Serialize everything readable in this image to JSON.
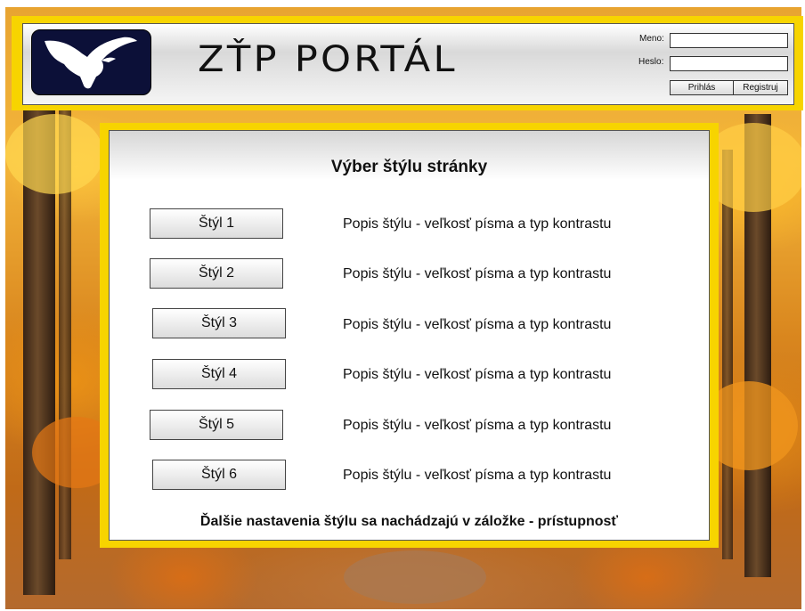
{
  "header": {
    "brand": "ZŤP PORTÁL",
    "login": {
      "username_label": "Meno:",
      "username_value": "",
      "password_label": "Heslo:",
      "password_value": "",
      "login_button": "Prihlás",
      "register_button": "Registruj"
    }
  },
  "main": {
    "title": "Výber štýlu stránky",
    "styles": [
      {
        "label": "Štýl 1",
        "description": "Popis štýlu - veľkosť písma a typ kontrastu"
      },
      {
        "label": "Štýl 2",
        "description": "Popis štýlu - veľkosť písma a typ kontrastu"
      },
      {
        "label": "Štýl 3",
        "description": "Popis štýlu - veľkosť písma a typ kontrastu"
      },
      {
        "label": "Štýl 4",
        "description": "Popis štýlu - veľkosť písma a typ kontrastu"
      },
      {
        "label": "Štýl 5",
        "description": "Popis štýlu - veľkosť písma a typ kontrastu"
      },
      {
        "label": "Štýl 6",
        "description": "Popis štýlu - veľkosť písma a typ kontrastu"
      }
    ],
    "footer_note": "Ďalšie nastavenia štýlu sa nachádzajú v záložke - prístupnosť"
  },
  "icons": {
    "logo": "dove-icon"
  },
  "colors": {
    "frame_yellow": "#f7d400",
    "logo_navy": "#0c1038",
    "background_autumn": "#e8a431"
  }
}
